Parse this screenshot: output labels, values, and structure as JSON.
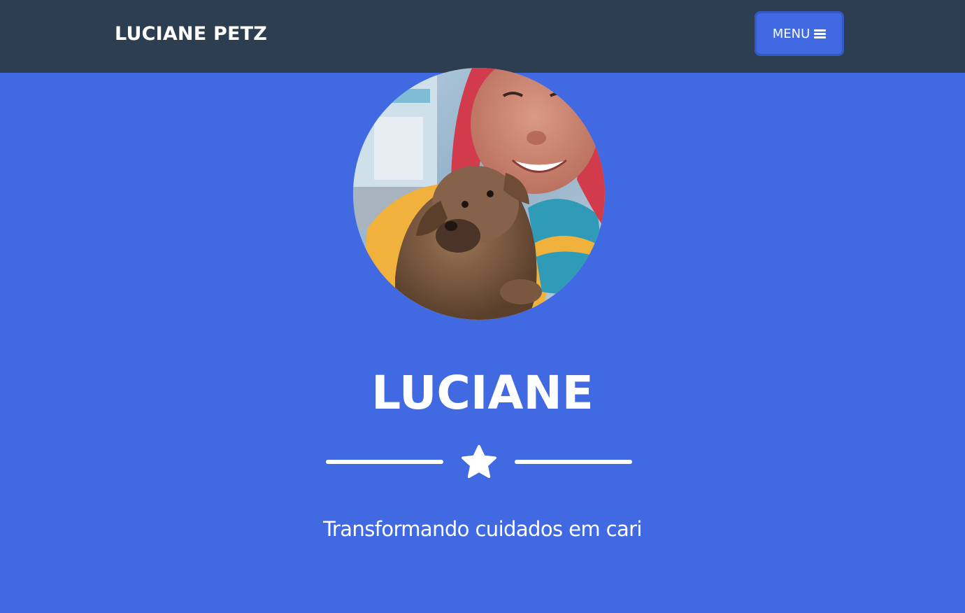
{
  "navbar": {
    "brand": "LUCIANE PETZ",
    "menu_label": "MENU",
    "menu_icon": "bars-icon"
  },
  "masthead": {
    "avatar": "profile-photo-with-dog",
    "heading": "LUCIANE",
    "divider_icon": "star-icon",
    "subheading": "Transformando cuidados em cari"
  },
  "colors": {
    "navbar_bg": "#2c3e50",
    "accent": "#4169e1",
    "text": "#ffffff"
  }
}
